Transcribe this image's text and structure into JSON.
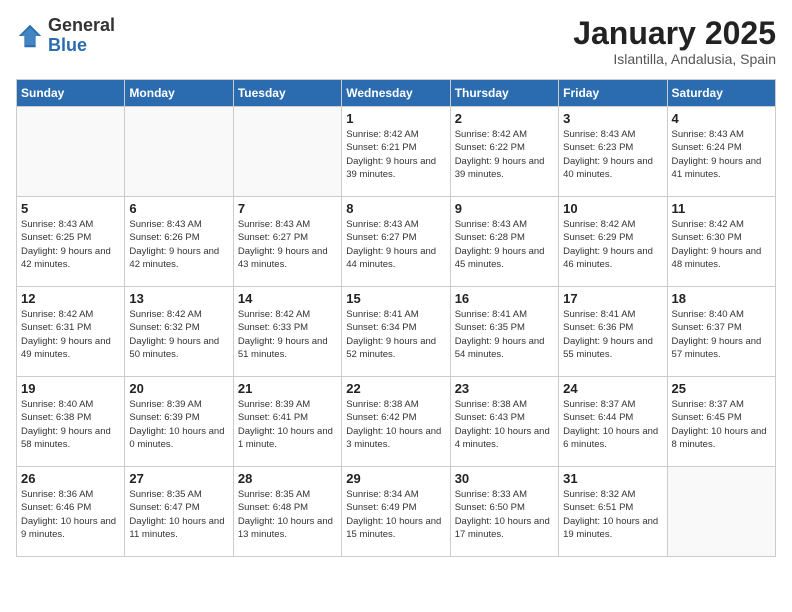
{
  "logo": {
    "general": "General",
    "blue": "Blue"
  },
  "title": {
    "month": "January 2025",
    "location": "Islantilla, Andalusia, Spain"
  },
  "weekdays": [
    "Sunday",
    "Monday",
    "Tuesday",
    "Wednesday",
    "Thursday",
    "Friday",
    "Saturday"
  ],
  "weeks": [
    [
      {
        "day": "",
        "sunrise": "",
        "sunset": "",
        "daylight": ""
      },
      {
        "day": "",
        "sunrise": "",
        "sunset": "",
        "daylight": ""
      },
      {
        "day": "",
        "sunrise": "",
        "sunset": "",
        "daylight": ""
      },
      {
        "day": "1",
        "sunrise": "Sunrise: 8:42 AM",
        "sunset": "Sunset: 6:21 PM",
        "daylight": "Daylight: 9 hours and 39 minutes."
      },
      {
        "day": "2",
        "sunrise": "Sunrise: 8:42 AM",
        "sunset": "Sunset: 6:22 PM",
        "daylight": "Daylight: 9 hours and 39 minutes."
      },
      {
        "day": "3",
        "sunrise": "Sunrise: 8:43 AM",
        "sunset": "Sunset: 6:23 PM",
        "daylight": "Daylight: 9 hours and 40 minutes."
      },
      {
        "day": "4",
        "sunrise": "Sunrise: 8:43 AM",
        "sunset": "Sunset: 6:24 PM",
        "daylight": "Daylight: 9 hours and 41 minutes."
      }
    ],
    [
      {
        "day": "5",
        "sunrise": "Sunrise: 8:43 AM",
        "sunset": "Sunset: 6:25 PM",
        "daylight": "Daylight: 9 hours and 42 minutes."
      },
      {
        "day": "6",
        "sunrise": "Sunrise: 8:43 AM",
        "sunset": "Sunset: 6:26 PM",
        "daylight": "Daylight: 9 hours and 42 minutes."
      },
      {
        "day": "7",
        "sunrise": "Sunrise: 8:43 AM",
        "sunset": "Sunset: 6:27 PM",
        "daylight": "Daylight: 9 hours and 43 minutes."
      },
      {
        "day": "8",
        "sunrise": "Sunrise: 8:43 AM",
        "sunset": "Sunset: 6:27 PM",
        "daylight": "Daylight: 9 hours and 44 minutes."
      },
      {
        "day": "9",
        "sunrise": "Sunrise: 8:43 AM",
        "sunset": "Sunset: 6:28 PM",
        "daylight": "Daylight: 9 hours and 45 minutes."
      },
      {
        "day": "10",
        "sunrise": "Sunrise: 8:42 AM",
        "sunset": "Sunset: 6:29 PM",
        "daylight": "Daylight: 9 hours and 46 minutes."
      },
      {
        "day": "11",
        "sunrise": "Sunrise: 8:42 AM",
        "sunset": "Sunset: 6:30 PM",
        "daylight": "Daylight: 9 hours and 48 minutes."
      }
    ],
    [
      {
        "day": "12",
        "sunrise": "Sunrise: 8:42 AM",
        "sunset": "Sunset: 6:31 PM",
        "daylight": "Daylight: 9 hours and 49 minutes."
      },
      {
        "day": "13",
        "sunrise": "Sunrise: 8:42 AM",
        "sunset": "Sunset: 6:32 PM",
        "daylight": "Daylight: 9 hours and 50 minutes."
      },
      {
        "day": "14",
        "sunrise": "Sunrise: 8:42 AM",
        "sunset": "Sunset: 6:33 PM",
        "daylight": "Daylight: 9 hours and 51 minutes."
      },
      {
        "day": "15",
        "sunrise": "Sunrise: 8:41 AM",
        "sunset": "Sunset: 6:34 PM",
        "daylight": "Daylight: 9 hours and 52 minutes."
      },
      {
        "day": "16",
        "sunrise": "Sunrise: 8:41 AM",
        "sunset": "Sunset: 6:35 PM",
        "daylight": "Daylight: 9 hours and 54 minutes."
      },
      {
        "day": "17",
        "sunrise": "Sunrise: 8:41 AM",
        "sunset": "Sunset: 6:36 PM",
        "daylight": "Daylight: 9 hours and 55 minutes."
      },
      {
        "day": "18",
        "sunrise": "Sunrise: 8:40 AM",
        "sunset": "Sunset: 6:37 PM",
        "daylight": "Daylight: 9 hours and 57 minutes."
      }
    ],
    [
      {
        "day": "19",
        "sunrise": "Sunrise: 8:40 AM",
        "sunset": "Sunset: 6:38 PM",
        "daylight": "Daylight: 9 hours and 58 minutes."
      },
      {
        "day": "20",
        "sunrise": "Sunrise: 8:39 AM",
        "sunset": "Sunset: 6:39 PM",
        "daylight": "Daylight: 10 hours and 0 minutes."
      },
      {
        "day": "21",
        "sunrise": "Sunrise: 8:39 AM",
        "sunset": "Sunset: 6:41 PM",
        "daylight": "Daylight: 10 hours and 1 minute."
      },
      {
        "day": "22",
        "sunrise": "Sunrise: 8:38 AM",
        "sunset": "Sunset: 6:42 PM",
        "daylight": "Daylight: 10 hours and 3 minutes."
      },
      {
        "day": "23",
        "sunrise": "Sunrise: 8:38 AM",
        "sunset": "Sunset: 6:43 PM",
        "daylight": "Daylight: 10 hours and 4 minutes."
      },
      {
        "day": "24",
        "sunrise": "Sunrise: 8:37 AM",
        "sunset": "Sunset: 6:44 PM",
        "daylight": "Daylight: 10 hours and 6 minutes."
      },
      {
        "day": "25",
        "sunrise": "Sunrise: 8:37 AM",
        "sunset": "Sunset: 6:45 PM",
        "daylight": "Daylight: 10 hours and 8 minutes."
      }
    ],
    [
      {
        "day": "26",
        "sunrise": "Sunrise: 8:36 AM",
        "sunset": "Sunset: 6:46 PM",
        "daylight": "Daylight: 10 hours and 9 minutes."
      },
      {
        "day": "27",
        "sunrise": "Sunrise: 8:35 AM",
        "sunset": "Sunset: 6:47 PM",
        "daylight": "Daylight: 10 hours and 11 minutes."
      },
      {
        "day": "28",
        "sunrise": "Sunrise: 8:35 AM",
        "sunset": "Sunset: 6:48 PM",
        "daylight": "Daylight: 10 hours and 13 minutes."
      },
      {
        "day": "29",
        "sunrise": "Sunrise: 8:34 AM",
        "sunset": "Sunset: 6:49 PM",
        "daylight": "Daylight: 10 hours and 15 minutes."
      },
      {
        "day": "30",
        "sunrise": "Sunrise: 8:33 AM",
        "sunset": "Sunset: 6:50 PM",
        "daylight": "Daylight: 10 hours and 17 minutes."
      },
      {
        "day": "31",
        "sunrise": "Sunrise: 8:32 AM",
        "sunset": "Sunset: 6:51 PM",
        "daylight": "Daylight: 10 hours and 19 minutes."
      },
      {
        "day": "",
        "sunrise": "",
        "sunset": "",
        "daylight": ""
      }
    ]
  ]
}
